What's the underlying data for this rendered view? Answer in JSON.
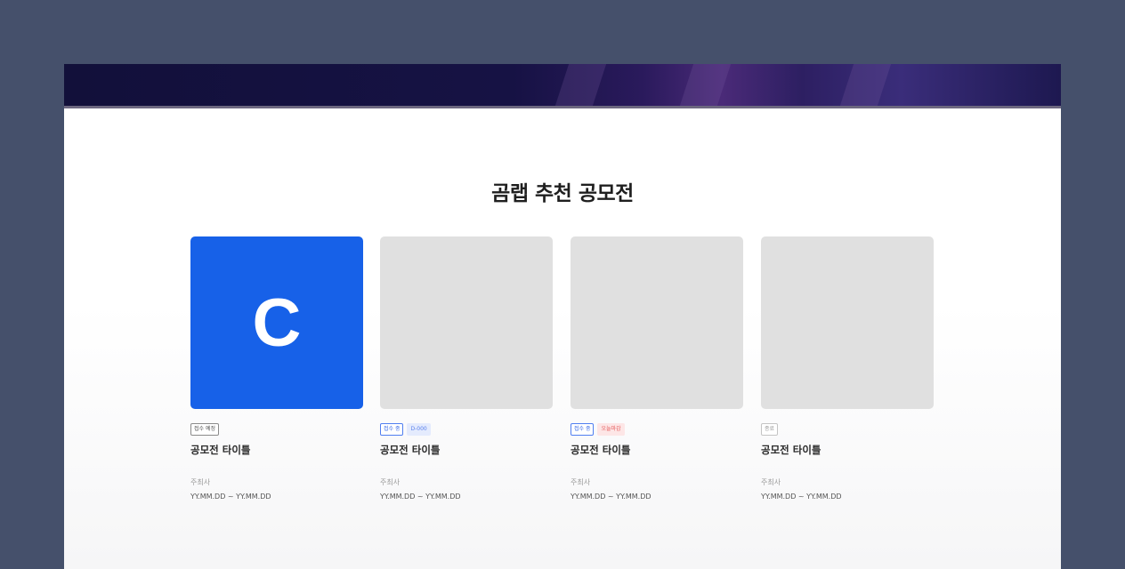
{
  "section": {
    "title": "곰랩 추천 공모전"
  },
  "cards": [
    {
      "logo_letter": "C",
      "badges": [
        "접수 예정"
      ],
      "title": "공모전 타이틀",
      "host": "주최사",
      "date": "YY.MM.DD ~ YY.MM.DD"
    },
    {
      "badges": [
        "접수 중",
        "D-000"
      ],
      "title": "공모전 타이틀",
      "host": "주최사",
      "date": "YY.MM.DD ~ YY.MM.DD"
    },
    {
      "badges": [
        "접수 중",
        "오늘마감"
      ],
      "title": "공모전 타이틀",
      "host": "주최사",
      "date": "YY.MM.DD ~ YY.MM.DD"
    },
    {
      "badges": [
        "종료"
      ],
      "title": "공모전 타이틀",
      "host": "주최사",
      "date": "YY.MM.DD ~ YY.MM.DD"
    }
  ],
  "colors": {
    "page_bg": "#45506b",
    "brand_blue": "#1761e8",
    "placeholder": "#e0e0e0",
    "banner": "#161244"
  }
}
